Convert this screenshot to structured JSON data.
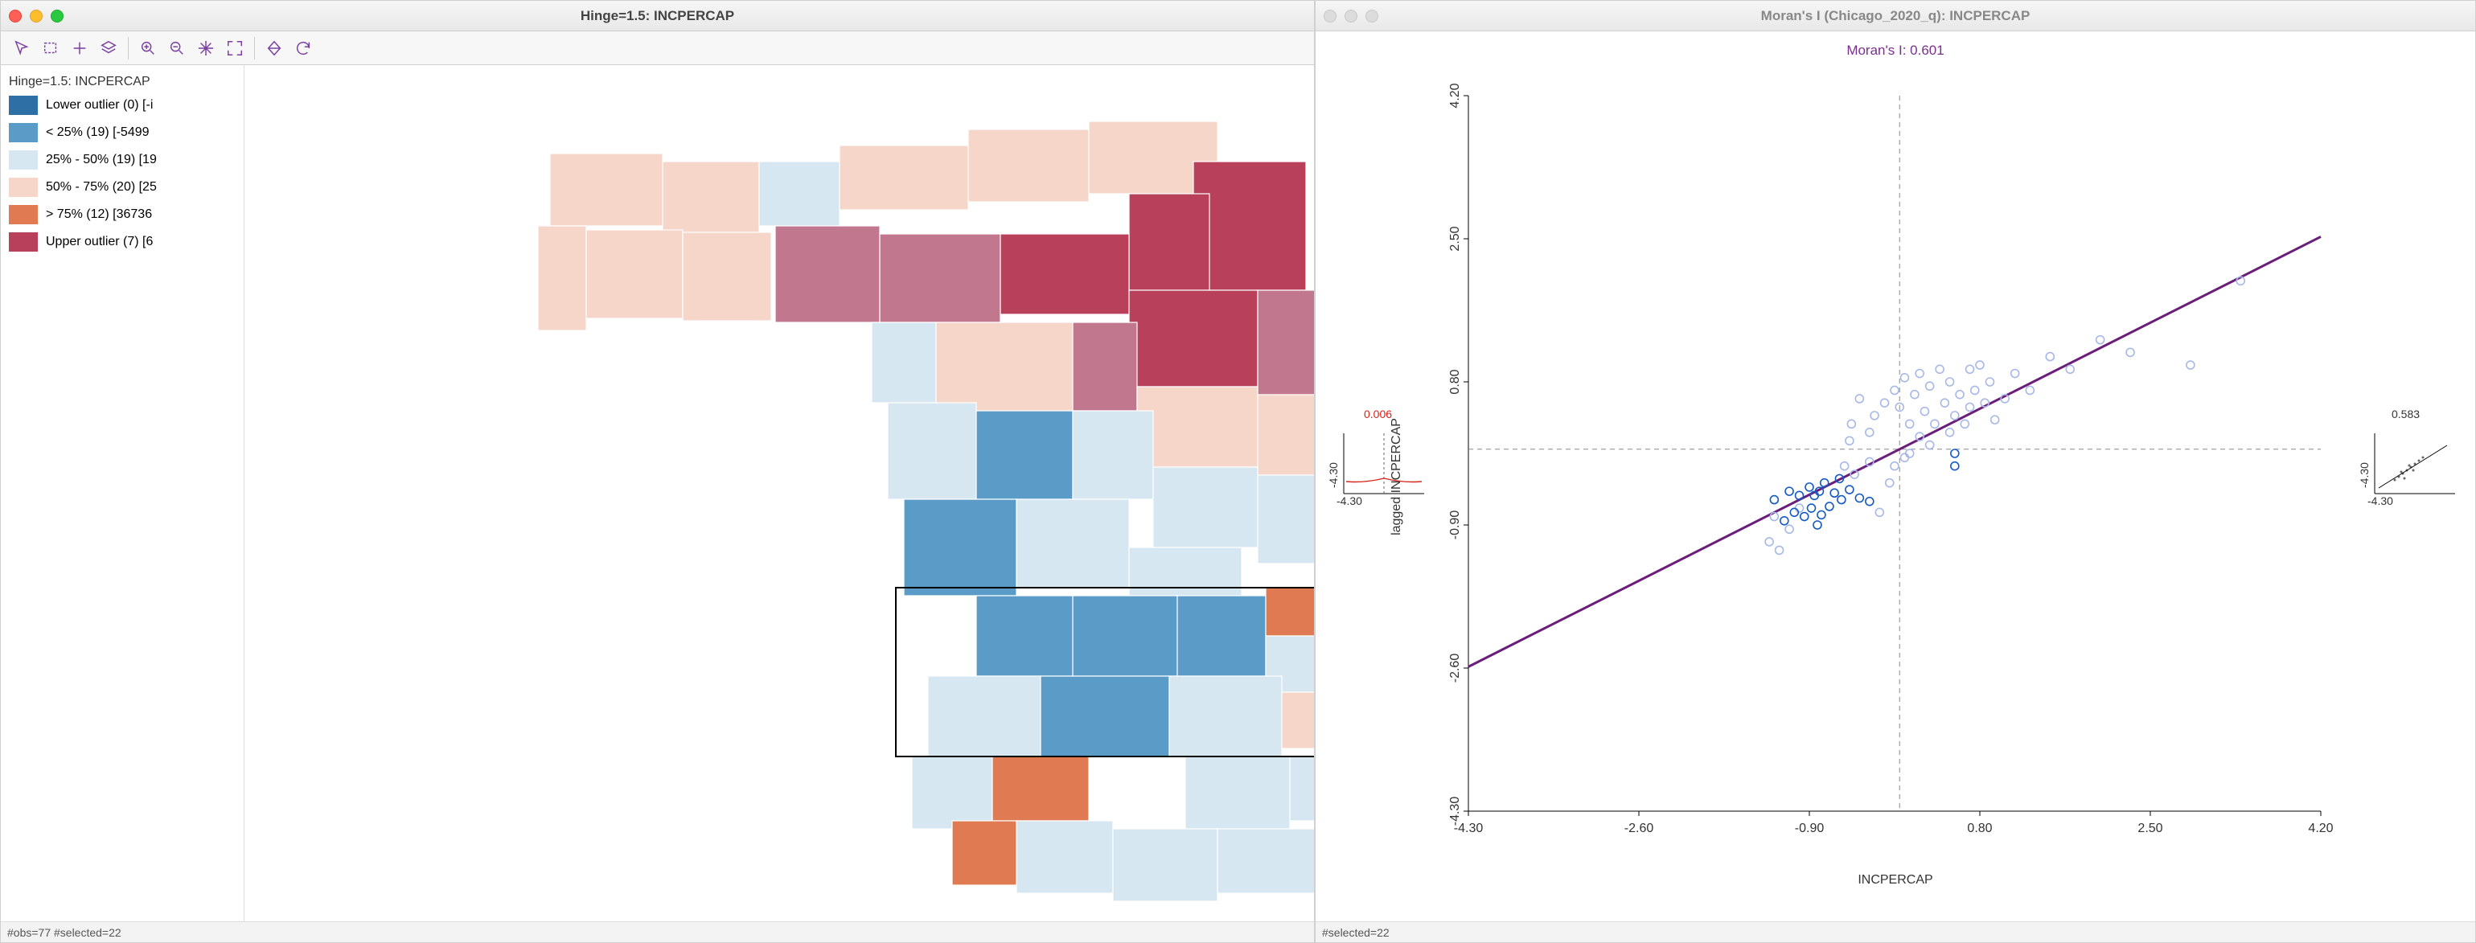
{
  "left_window": {
    "title": "Hinge=1.5: INCPERCAP",
    "toolbar": [
      "pointer",
      "select-rect",
      "add",
      "layers",
      "zoom-in",
      "zoom-out",
      "pan",
      "extent",
      "diamond",
      "refresh"
    ],
    "legend_title": "Hinge=1.5: INCPERCAP",
    "legend_items": [
      {
        "color": "#2e6fa6",
        "label": "Lower outlier (0)  [-i"
      },
      {
        "color": "#5a9bc7",
        "label": "< 25% (19)  [-5499"
      },
      {
        "color": "#d6e7f1",
        "label": "25% - 50% (19)  [19"
      },
      {
        "color": "#f6d6c8",
        "label": "50% - 75% (20)  [25"
      },
      {
        "color": "#e07a52",
        "label": "> 75% (12)  [36736"
      },
      {
        "color": "#b8405a",
        "label": "Upper outlier (7)  [6"
      }
    ],
    "status": "#obs=77 #selected=22"
  },
  "right_window": {
    "title": "Moran's I (Chicago_2020_q): INCPERCAP",
    "moran_label": "Moran's I: 0.601",
    "xlabel": "INCPERCAP",
    "ylabel": "lagged INCPERCAP",
    "thumb_left_value": "0.006",
    "thumb_left_tick": "-4.30",
    "thumb_left_tick2": "-4.30",
    "thumb_right_value": "0.583",
    "thumb_right_tick": "-4.30",
    "thumb_right_tick2": "-4.30",
    "status": "#selected=22"
  },
  "chart_data": {
    "type": "scatter",
    "title": "Moran's I: 0.601",
    "xlabel": "INCPERCAP",
    "ylabel": "lagged INCPERCAP",
    "xlim": [
      -4.3,
      4.2
    ],
    "ylim": [
      -4.3,
      4.2
    ],
    "xticks": [
      -4.3,
      -2.6,
      -0.9,
      0.8,
      2.5,
      4.2
    ],
    "yticks": [
      -4.3,
      -2.6,
      -0.9,
      0.8,
      2.5,
      4.2
    ],
    "reference_lines": {
      "x": 0,
      "y": 0
    },
    "regression": {
      "slope": 0.601,
      "intercept": 0
    },
    "series": [
      {
        "name": "unselected",
        "color": "#a7b8e8",
        "points": [
          [
            -1.3,
            -1.1
          ],
          [
            -1.25,
            -0.8
          ],
          [
            -1.2,
            -1.2
          ],
          [
            -1.1,
            -0.95
          ],
          [
            -1.0,
            -0.7
          ],
          [
            -0.55,
            -0.2
          ],
          [
            -0.5,
            0.1
          ],
          [
            -0.48,
            0.3
          ],
          [
            -0.45,
            -0.3
          ],
          [
            -0.4,
            0.6
          ],
          [
            -0.3,
            0.2
          ],
          [
            -0.3,
            -0.15
          ],
          [
            -0.25,
            0.4
          ],
          [
            -0.2,
            -0.75
          ],
          [
            -0.15,
            0.55
          ],
          [
            -0.1,
            -0.4
          ],
          [
            -0.05,
            0.7
          ],
          [
            -0.05,
            -0.2
          ],
          [
            0.0,
            0.5
          ],
          [
            0.05,
            -0.1
          ],
          [
            0.05,
            0.85
          ],
          [
            0.1,
            0.3
          ],
          [
            0.1,
            -0.05
          ],
          [
            0.15,
            0.65
          ],
          [
            0.2,
            0.15
          ],
          [
            0.2,
            0.9
          ],
          [
            0.25,
            0.45
          ],
          [
            0.3,
            0.05
          ],
          [
            0.3,
            0.75
          ],
          [
            0.35,
            0.3
          ],
          [
            0.4,
            0.95
          ],
          [
            0.45,
            0.55
          ],
          [
            0.5,
            0.2
          ],
          [
            0.5,
            0.8
          ],
          [
            0.55,
            0.4
          ],
          [
            0.6,
            0.65
          ],
          [
            0.65,
            0.3
          ],
          [
            0.7,
            0.95
          ],
          [
            0.7,
            0.5
          ],
          [
            0.75,
            0.7
          ],
          [
            0.8,
            1.0
          ],
          [
            0.85,
            0.55
          ],
          [
            0.9,
            0.8
          ],
          [
            0.95,
            0.35
          ],
          [
            1.05,
            0.6
          ],
          [
            1.15,
            0.9
          ],
          [
            1.3,
            0.7
          ],
          [
            1.5,
            1.1
          ],
          [
            1.7,
            0.95
          ],
          [
            2.0,
            1.3
          ],
          [
            2.3,
            1.15
          ],
          [
            2.9,
            1.0
          ],
          [
            3.4,
            2.0
          ]
        ]
      },
      {
        "name": "selected",
        "color": "#1559c4",
        "points": [
          [
            -1.25,
            -0.6
          ],
          [
            -1.15,
            -0.85
          ],
          [
            -1.1,
            -0.5
          ],
          [
            -1.05,
            -0.75
          ],
          [
            -1.0,
            -0.55
          ],
          [
            -0.95,
            -0.8
          ],
          [
            -0.9,
            -0.45
          ],
          [
            -0.88,
            -0.7
          ],
          [
            -0.85,
            -0.55
          ],
          [
            -0.82,
            -0.9
          ],
          [
            -0.8,
            -0.5
          ],
          [
            -0.78,
            -0.78
          ],
          [
            -0.75,
            -0.4
          ],
          [
            -0.7,
            -0.68
          ],
          [
            -0.65,
            -0.52
          ],
          [
            -0.6,
            -0.35
          ],
          [
            -0.58,
            -0.6
          ],
          [
            -0.5,
            -0.48
          ],
          [
            -0.4,
            -0.58
          ],
          [
            -0.3,
            -0.62
          ],
          [
            0.55,
            -0.05
          ],
          [
            0.55,
            -0.2
          ]
        ]
      }
    ],
    "inset_left": {
      "mean": 0.006,
      "range": [
        -4.3,
        4.3
      ]
    },
    "inset_right": {
      "slope": 0.583,
      "range": [
        -4.3,
        4.3
      ]
    }
  }
}
